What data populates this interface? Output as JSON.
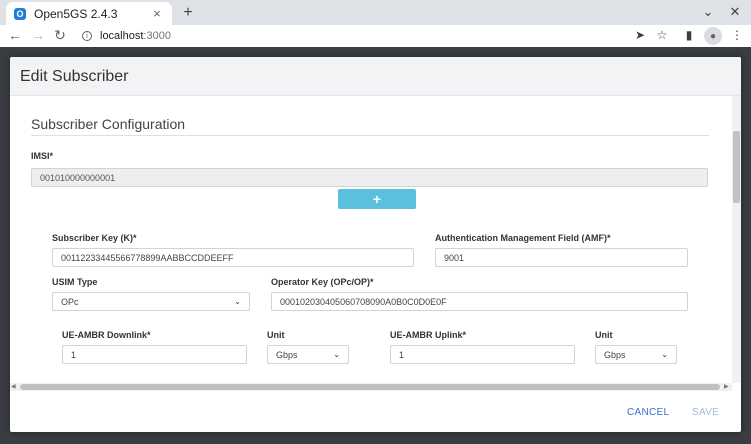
{
  "browser": {
    "tab_title": "Open5GS 2.4.3",
    "favicon_glyph": "O",
    "tab_close": "×",
    "new_tab": "+",
    "url_host": "localhost",
    "url_port": ":3000"
  },
  "modal": {
    "title": "Edit Subscriber",
    "section_title": "Subscriber Configuration",
    "imsi": {
      "label": "IMSI*",
      "value": "001010000000001"
    },
    "add_button_label": "+",
    "subscriber_key": {
      "label": "Subscriber Key (K)*",
      "value": "00112233445566778899AABBCCDDEEFF"
    },
    "amf": {
      "label": "Authentication Management Field (AMF)*",
      "value": "9001"
    },
    "usim_type": {
      "label": "USIM Type",
      "value": "OPc"
    },
    "operator_key": {
      "label": "Operator Key (OPc/OP)*",
      "value": "000102030405060708090A0B0C0D0E0F"
    },
    "ue_ambr_downlink": {
      "label": "UE-AMBR Downlink*",
      "value": "1"
    },
    "downlink_unit": {
      "label": "Unit",
      "value": "Gbps"
    },
    "ue_ambr_uplink": {
      "label": "UE-AMBR Uplink*",
      "value": "1"
    },
    "uplink_unit": {
      "label": "Unit",
      "value": "Gbps"
    },
    "cancel_label": "CANCEL",
    "save_label": "SAVE"
  },
  "colors": {
    "accent": "#3b6fd8",
    "add_button": "#5bc0de",
    "header_bg": "#f1f3f5",
    "overlay": "#3a3d41"
  }
}
